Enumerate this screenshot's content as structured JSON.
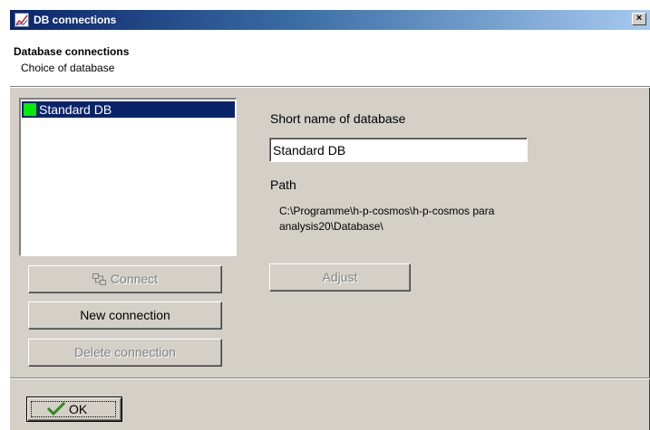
{
  "window": {
    "title": "DB connections",
    "close_label": "×",
    "app_icon": "db-connections-app-icon"
  },
  "header": {
    "title": "Database connections",
    "subtitle": "Choice of database"
  },
  "connections": {
    "items": [
      {
        "label": "Standard DB",
        "status_color": "#00ee00",
        "selected": true
      }
    ]
  },
  "buttons": {
    "connect": "Connect",
    "connect_icon": "connect-icon",
    "new_connection": "New connection",
    "delete_connection": "Delete connection",
    "adjust": "Adjust",
    "ok": "OK",
    "ok_icon": "checkmark-icon"
  },
  "details": {
    "short_name_label": "Short name of database",
    "short_name_value": "Standard DB",
    "path_label": "Path",
    "path_value": "C:\\Programme\\h-p-cosmos\\h-p-cosmos para analysis20\\Database\\"
  },
  "colors": {
    "titlebar_start": "#0a246a",
    "titlebar_end": "#a6caf0",
    "selection": "#0a246a",
    "face": "#d4d0c8",
    "status_ok": "#00ee00",
    "checkmark": "#2e8b1e"
  }
}
